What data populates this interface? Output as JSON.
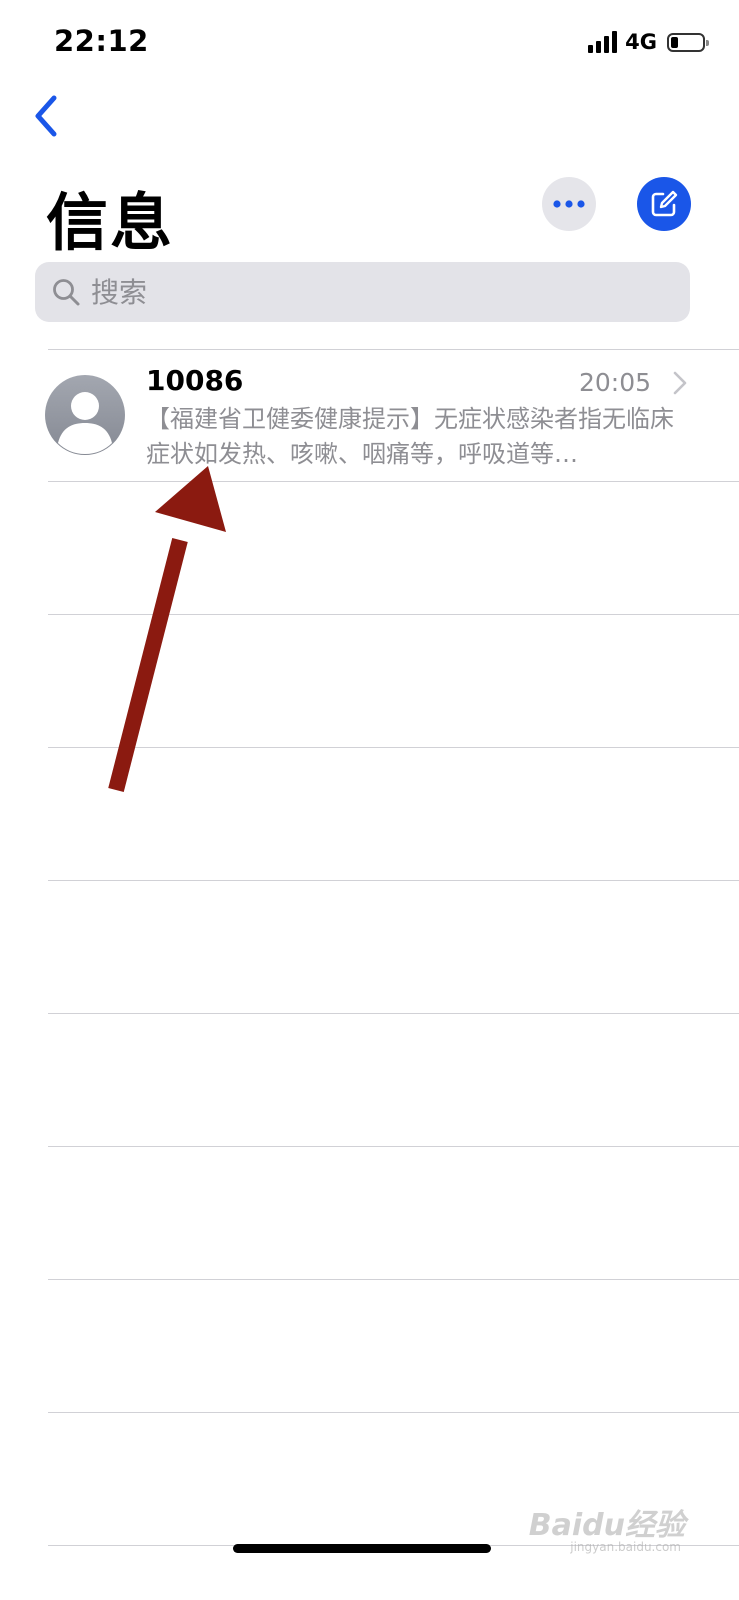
{
  "status_bar": {
    "time": "22:12",
    "network": "4G",
    "signal_bars": 4,
    "battery_level": 0.2
  },
  "nav": {
    "back_icon": "chevron-left-icon"
  },
  "header": {
    "title": "信息",
    "more_icon": "ellipsis-icon",
    "compose_icon": "compose-icon"
  },
  "search": {
    "placeholder": "搜索",
    "icon": "search-icon"
  },
  "conversations": [
    {
      "sender": "10086",
      "time": "20:05",
      "preview": "【福建省卫健委健康提示】无症状感染者指无临床症状如发热、咳嗽、咽痛等，呼吸道等…"
    }
  ],
  "watermark": {
    "text": "Baidu经验",
    "sub": "jingyan.baidu.com"
  },
  "colors": {
    "accent": "#1a56e8",
    "annotation_arrow": "#8b1a10",
    "secondary_text": "#8e8e93",
    "search_bg": "#e3e3e8"
  }
}
